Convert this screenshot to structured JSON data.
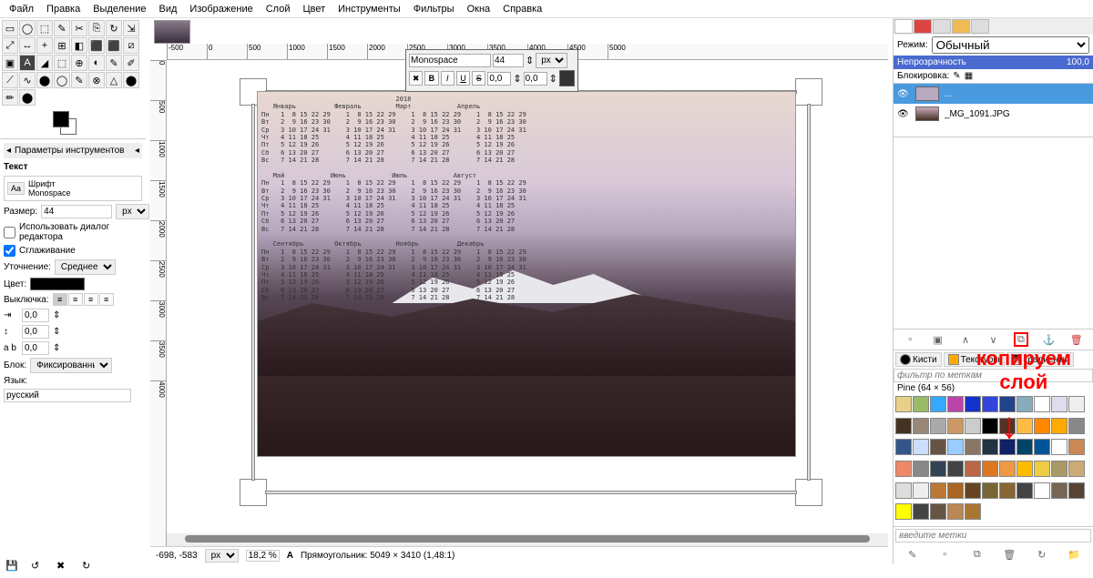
{
  "menu": [
    "Файл",
    "Правка",
    "Выделение",
    "Вид",
    "Изображение",
    "Слой",
    "Цвет",
    "Инструменты",
    "Фильтры",
    "Окна",
    "Справка"
  ],
  "tool_options": {
    "header": "Параметры инструментов",
    "section": "Текст",
    "font_label": "Шрифт",
    "font": "Monospace",
    "size_label": "Размер:",
    "size": "44",
    "unit": "px",
    "editor_dialog": "Использовать диалог редактора",
    "antialias": "Сглаживание",
    "hinting_label": "Уточнение:",
    "hinting": "Среднее",
    "color_label": "Цвет:",
    "justify_label": "Выключка:",
    "indent": "0,0",
    "line_spacing": "0,0",
    "letter_spacing": "0,0",
    "box_label": "Блок:",
    "box": "Фиксированный",
    "lang_label": "Язык:",
    "lang": "русский"
  },
  "text_toolbar": {
    "font": "Monospace",
    "size": "44",
    "unit": "px",
    "val1": "0,0",
    "val2": "0,0"
  },
  "calendar_year": "2018",
  "calendar_months": [
    "Январь",
    "Февраль",
    "Март",
    "Апрель",
    "Май",
    "Июнь",
    "Июль",
    "Август",
    "Сентябрь",
    "Октябрь",
    "Ноябрь",
    "Декабрь"
  ],
  "status": {
    "pos": "-698, -583",
    "unit": "px",
    "zoom": "18,2 %",
    "info": "Прямоугольник: 5049 × 3410 (1,48:1)"
  },
  "layers_panel": {
    "mode_label": "Режим:",
    "mode": "Обычный",
    "opacity_label": "Непрозрачность",
    "opacity_val": "100,0",
    "lock_label": "Блокировка:",
    "layers": [
      {
        "name": "...",
        "sel": true
      },
      {
        "name": "_MG_1091.JPG",
        "sel": false
      }
    ]
  },
  "annotation": {
    "line1": "копируем",
    "line2": "слой"
  },
  "brush_tabs": [
    "Кисти",
    "Текстуры",
    "Градиенты"
  ],
  "pattern_filter": "фильтр по меткам",
  "pattern_name": "Pine (64 × 56)",
  "tags_input": "введите метки",
  "ruler_ticks": [
    "0",
    "500",
    "1000",
    "1500",
    "2000",
    "2500",
    "3000",
    "3500",
    "4000",
    "4500",
    "5000"
  ],
  "pattern_colors": [
    "#e8d088",
    "#9b6",
    "#3af",
    "#b4a",
    "#13c",
    "#34d",
    "#248",
    "#8ab",
    "#fff",
    "#dde",
    "#eee",
    "#432",
    "#987",
    "#aaa",
    "#c96",
    "#ccc",
    "#000",
    "#532",
    "#fb4",
    "#f80",
    "#fa0",
    "#888",
    "#358",
    "#cdf",
    "#654",
    "#9cf",
    "#876",
    "#234",
    "#126",
    "#046",
    "#059",
    "#fff",
    "#c85",
    "#e86",
    "#888",
    "#345",
    "#444",
    "#b64",
    "#d72",
    "#e94",
    "#fb0",
    "#ec4",
    "#a96",
    "#ca7",
    "#ddd",
    "#eee",
    "#b73",
    "#a62",
    "#642",
    "#763",
    "#863",
    "#444",
    "#fff",
    "#765",
    "#543",
    "#ff0",
    "#444",
    "#654",
    "#b85",
    "#a73"
  ],
  "tool_icons": [
    "▭",
    "◯",
    "⬚",
    "✎",
    "✂",
    "⎘",
    "↻",
    "⇲",
    "⤢",
    "↔",
    "+",
    "⊞",
    "◧",
    "⬛",
    "⬛",
    "⧄",
    "▣",
    "A",
    "◢",
    "⬚",
    "⊕",
    "◐",
    "✎",
    "✐",
    "⟋",
    "∿",
    "⬤",
    "◯",
    "✎",
    "⊗",
    "△",
    "⬤",
    "✏",
    "⬤"
  ]
}
